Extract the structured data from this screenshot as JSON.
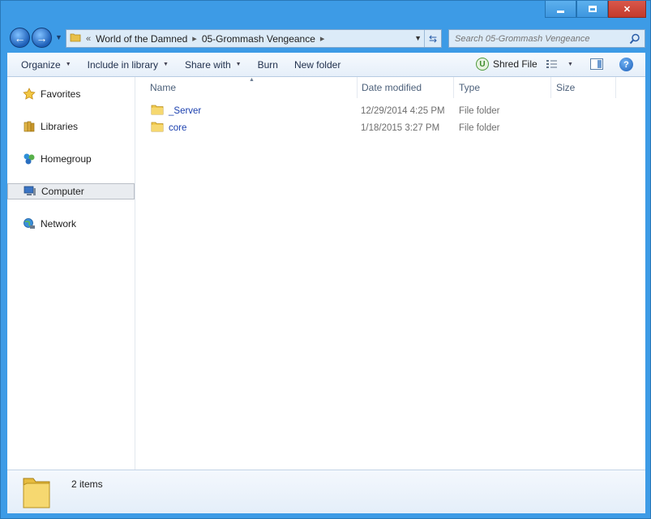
{
  "window": {
    "caption_buttons": [
      "minimize",
      "maximize",
      "close"
    ]
  },
  "nav": {
    "back_label": "Back",
    "forward_label": "Forward",
    "breadcrumb_overflow": "«",
    "breadcrumbs": [
      "World of the Damned",
      "05-Grommash Vengeance"
    ],
    "search_placeholder": "Search 05-Grommash Vengeance"
  },
  "toolbar": {
    "organize": "Organize",
    "include_in_library": "Include in library",
    "share_with": "Share with",
    "burn": "Burn",
    "new_folder": "New folder",
    "shred_file": "Shred File",
    "shred_icon_letter": "U",
    "help": "?"
  },
  "sidebar": {
    "items": [
      {
        "label": "Favorites",
        "icon": "star-icon"
      },
      {
        "label": "Libraries",
        "icon": "library-icon"
      },
      {
        "label": "Homegroup",
        "icon": "homegroup-icon"
      },
      {
        "label": "Computer",
        "icon": "computer-icon",
        "selected": true
      },
      {
        "label": "Network",
        "icon": "network-icon"
      }
    ]
  },
  "columns": {
    "name": "Name",
    "date_modified": "Date modified",
    "type": "Type",
    "size": "Size"
  },
  "files": [
    {
      "name": "_Server",
      "date_modified": "12/29/2014 4:25 PM",
      "type": "File folder"
    },
    {
      "name": "core",
      "date_modified": "1/18/2015 3:27 PM",
      "type": "File folder"
    }
  ],
  "details": {
    "item_count": "2 items"
  },
  "colors": {
    "frame": "#3d9be6",
    "link_blue": "#1a3fae",
    "close_red": "#c33a2c"
  }
}
